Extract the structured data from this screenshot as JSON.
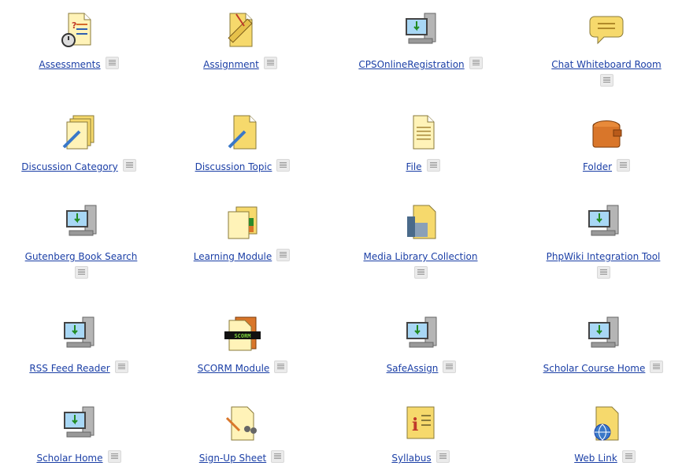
{
  "tools": [
    {
      "label": "Assessments",
      "icon": "assessment-icon"
    },
    {
      "label": "Assignment",
      "icon": "assignment-icon"
    },
    {
      "label": "CPSOnlineRegistration",
      "icon": "computer-tool-icon"
    },
    {
      "label": "Chat Whiteboard Room",
      "icon": "chat-bubble-icon"
    },
    {
      "label": "Discussion Category",
      "icon": "discussion-category-icon"
    },
    {
      "label": "Discussion Topic",
      "icon": "discussion-topic-icon"
    },
    {
      "label": "File",
      "icon": "file-icon"
    },
    {
      "label": "Folder",
      "icon": "folder-icon"
    },
    {
      "label": "Gutenberg Book Search",
      "icon": "computer-tool-icon"
    },
    {
      "label": "Learning Module",
      "icon": "learning-module-icon"
    },
    {
      "label": "Media Library Collection",
      "icon": "media-library-icon"
    },
    {
      "label": "PhpWiki Integration Tool",
      "icon": "computer-tool-icon"
    },
    {
      "label": "RSS Feed Reader",
      "icon": "computer-tool-icon"
    },
    {
      "label": "SCORM Module",
      "icon": "scorm-icon",
      "badge": "SCORM"
    },
    {
      "label": "SafeAssign",
      "icon": "computer-tool-icon"
    },
    {
      "label": "Scholar Course Home",
      "icon": "computer-tool-icon"
    },
    {
      "label": "Scholar Home",
      "icon": "computer-tool-icon"
    },
    {
      "label": "Sign-Up Sheet",
      "icon": "signup-sheet-icon"
    },
    {
      "label": "Syllabus",
      "icon": "syllabus-icon",
      "badge": "i"
    },
    {
      "label": "Web Link",
      "icon": "web-link-icon"
    }
  ],
  "colors": {
    "link": "#1b3fa6",
    "menu_button": "#ebebeb",
    "icon_yellow": "#f6d96c",
    "icon_orange": "#d9762a"
  }
}
